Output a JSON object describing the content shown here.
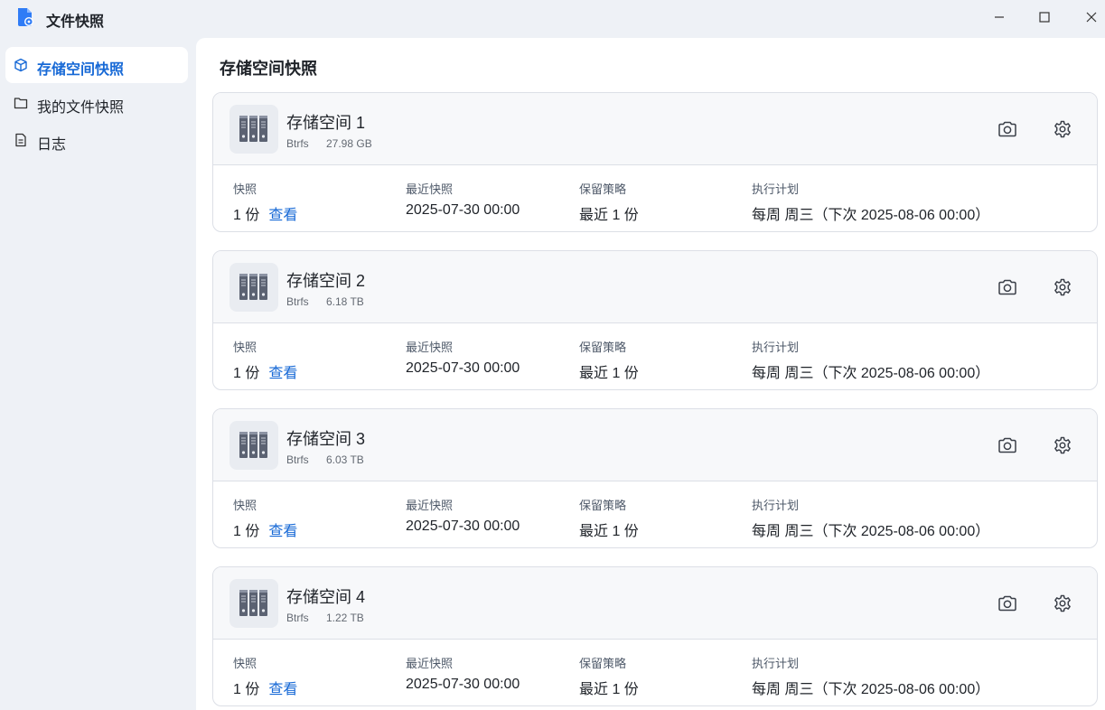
{
  "app": {
    "title": "文件快照"
  },
  "sidebar": {
    "items": [
      {
        "label": "存储空间快照",
        "icon": "cube-icon",
        "active": true
      },
      {
        "label": "我的文件快照",
        "icon": "folder-icon",
        "active": false
      },
      {
        "label": "日志",
        "icon": "document-icon",
        "active": false
      }
    ]
  },
  "main": {
    "title": "存储空间快照",
    "fields": {
      "snapshots": "快照",
      "latest": "最近快照",
      "retention": "保留策略",
      "schedule": "执行计划"
    },
    "view_link": "查看",
    "volumes": [
      {
        "name": "存储空间 1",
        "fs": "Btrfs",
        "size": "27.98 GB",
        "snapshots": "1 份",
        "latest": "2025-07-30 00:00",
        "retention": "最近 1 份",
        "schedule": "每周 周三（下次 2025-08-06 00:00）"
      },
      {
        "name": "存储空间 2",
        "fs": "Btrfs",
        "size": "6.18 TB",
        "snapshots": "1 份",
        "latest": "2025-07-30 00:00",
        "retention": "最近 1 份",
        "schedule": "每周 周三（下次 2025-08-06 00:00）"
      },
      {
        "name": "存储空间 3",
        "fs": "Btrfs",
        "size": "6.03 TB",
        "snapshots": "1 份",
        "latest": "2025-07-30 00:00",
        "retention": "最近 1 份",
        "schedule": "每周 周三（下次 2025-08-06 00:00）"
      },
      {
        "name": "存储空间 4",
        "fs": "Btrfs",
        "size": "1.22 TB",
        "snapshots": "1 份",
        "latest": "2025-07-30 00:00",
        "retention": "最近 1 份",
        "schedule": "每周 周三（下次 2025-08-06 00:00）"
      }
    ]
  },
  "colors": {
    "accent": "#1769d6",
    "sidebar_bg": "#eef1f6",
    "card_head_bg": "#f7f8fa"
  }
}
